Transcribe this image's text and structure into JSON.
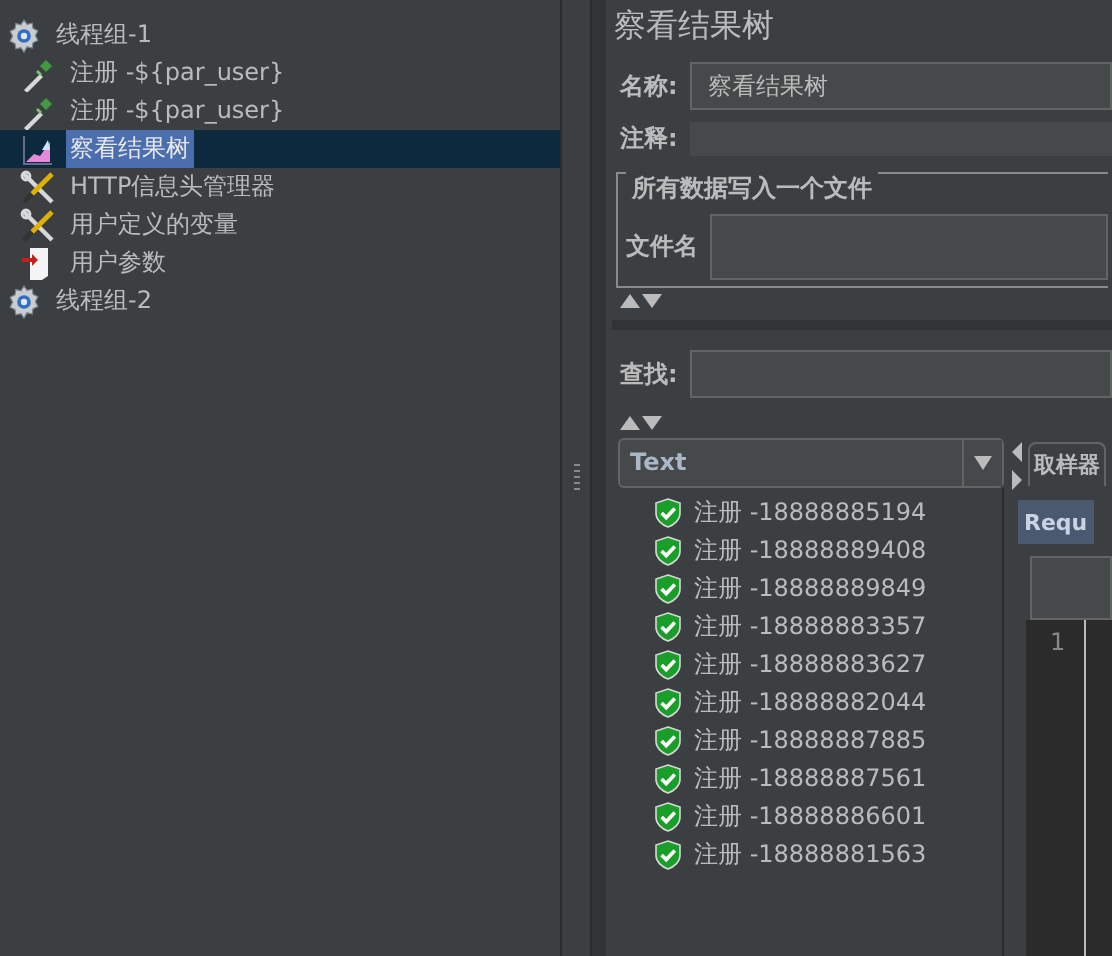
{
  "tree": [
    {
      "label": "线程组-1",
      "kind": "thread-group",
      "selected": false,
      "children": [
        {
          "label": "注册 -${par_user}",
          "kind": "sampler",
          "selected": false
        },
        {
          "label": "注册 -${par_user}",
          "kind": "sampler",
          "selected": false
        },
        {
          "label": "察看结果树",
          "kind": "listener",
          "selected": true
        },
        {
          "label": "HTTP信息头管理器",
          "kind": "config",
          "selected": false
        },
        {
          "label": "用户定义的变量",
          "kind": "config",
          "selected": false
        },
        {
          "label": "用户参数",
          "kind": "preprocessor",
          "selected": false
        }
      ]
    },
    {
      "label": "线程组-2",
      "kind": "thread-group",
      "selected": false
    }
  ],
  "panel": {
    "title": "察看结果树",
    "name_label": "名称:",
    "name_value": "察看结果树",
    "comment_label": "注释:",
    "file_group": {
      "title": "所有数据写入一个文件",
      "file_label": "文件名"
    },
    "search_label": "查找:",
    "renderer": {
      "value": "Text"
    },
    "results": [
      {
        "label": "注册 -18888885194"
      },
      {
        "label": "注册 -18888889408"
      },
      {
        "label": "注册 -18888889849"
      },
      {
        "label": "注册 -18888883357"
      },
      {
        "label": "注册 -18888883627"
      },
      {
        "label": "注册 -18888882044"
      },
      {
        "label": "注册 -18888887885"
      },
      {
        "label": "注册 -18888887561"
      },
      {
        "label": "注册 -18888886601"
      },
      {
        "label": "注册 -18888881563"
      }
    ],
    "result_tab": "取样器",
    "request_tab": "Requ",
    "line_number": "1"
  }
}
